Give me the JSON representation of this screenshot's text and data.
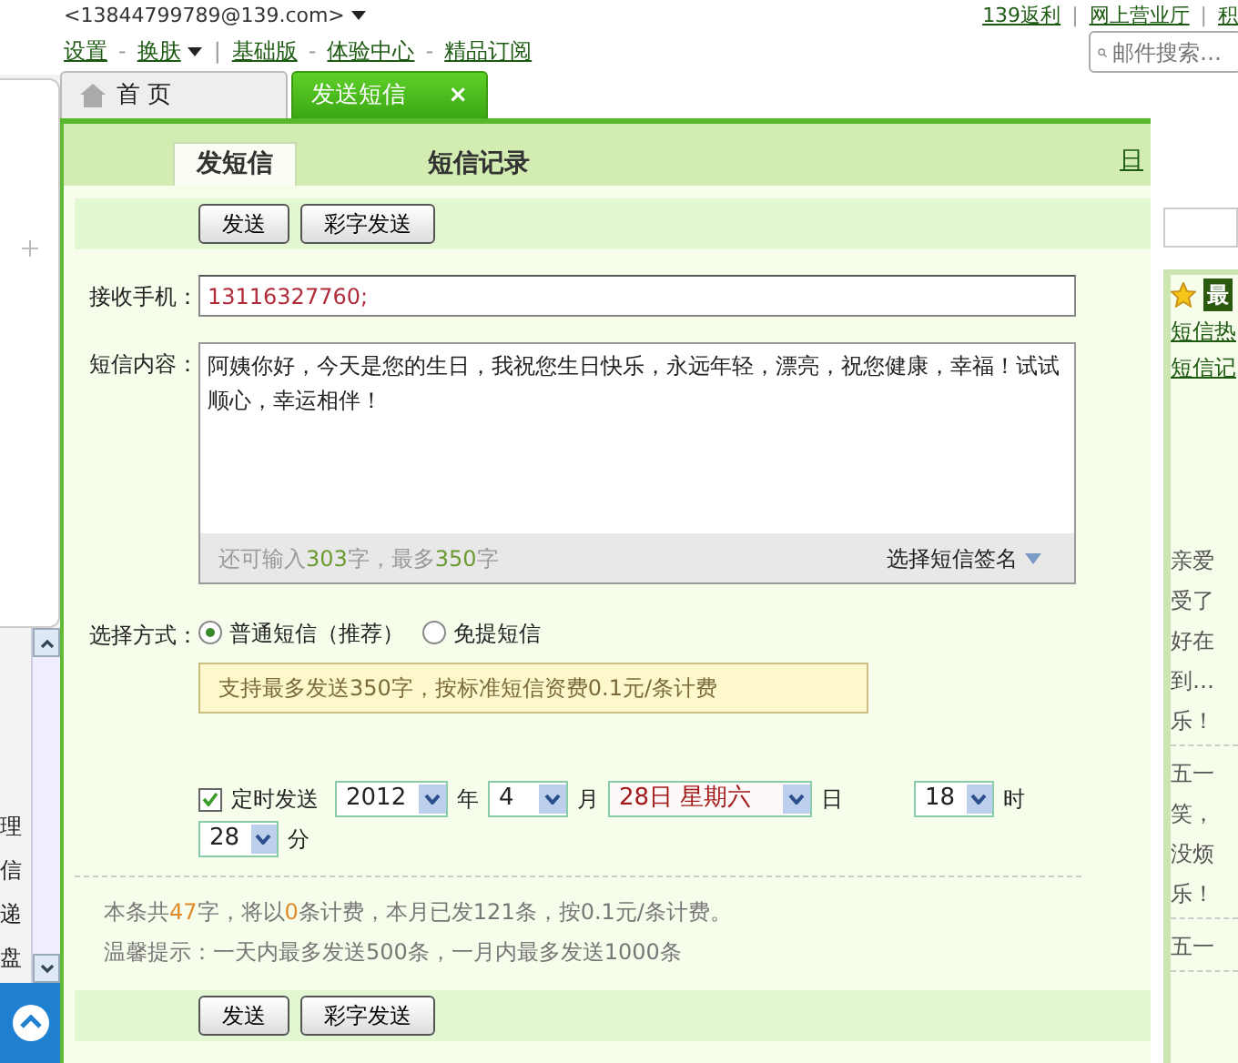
{
  "account": {
    "email": "<13844799789@139.com>"
  },
  "top_links": [
    {
      "label": "139返利"
    },
    {
      "label": "网上营业厅",
      "separator_before": "|"
    },
    {
      "label": "积",
      "separator_before": "|"
    }
  ],
  "menu": [
    {
      "label": "设置",
      "dropdown": false
    },
    {
      "label": "换肤",
      "separator_before": "-",
      "dropdown": true
    },
    {
      "label": "基础版",
      "separator_before": "|",
      "dropdown": false
    },
    {
      "label": "体验中心",
      "separator_before": "-",
      "dropdown": false
    },
    {
      "label": "精品订阅",
      "separator_before": "-",
      "dropdown": false
    }
  ],
  "search": {
    "placeholder": "邮件搜索…"
  },
  "tabs": [
    {
      "label": "首 页",
      "selected": false
    },
    {
      "label": "发送短信",
      "selected": true,
      "close": "×"
    }
  ],
  "subtabs": [
    {
      "label": "发短信",
      "selected": true
    },
    {
      "label": "短信记录",
      "selected": false
    }
  ],
  "subnav_right": "日",
  "toolbar_top": {
    "buttons": [
      "发送",
      "彩字发送"
    ]
  },
  "recipient": {
    "label": "接收手机：",
    "value": "13116327760;"
  },
  "content": {
    "label": "短信内容：",
    "value": "阿姨你好，今天是您的生日，我祝您生日快乐，永远年轻，漂亮，祝您健康，幸福！试试顺心，幸运相伴！",
    "counter": [
      {
        "text": "还可输入",
        "highlight": false
      },
      {
        "text": "303",
        "highlight": true
      },
      {
        "text": "字，最多",
        "highlight": false
      },
      {
        "text": "350",
        "highlight": true
      },
      {
        "text": "字",
        "highlight": false
      }
    ],
    "signature": "选择短信签名"
  },
  "send_mode": {
    "label": "选择方式：",
    "options": [
      {
        "label": "普通短信（推荐）",
        "selected": true
      },
      {
        "label": "免提短信",
        "selected": false
      }
    ],
    "tip": "支持最多发送350字，按标准短信资费0.1元/条计费"
  },
  "schedule": {
    "label": "定时发送",
    "checked": true,
    "fields": [
      {
        "value": "2012",
        "unit": "年",
        "highlight": false
      },
      {
        "value": "4",
        "unit": "月",
        "highlight": false
      },
      {
        "value": "28日 星期六",
        "unit": "日",
        "highlight": true
      },
      {
        "value": "18",
        "unit": "时",
        "highlight": false
      },
      {
        "value": "28",
        "unit": "分",
        "highlight": false
      }
    ]
  },
  "summary": [
    {
      "text": "本条共",
      "highlight": false
    },
    {
      "text": "47",
      "highlight": true
    },
    {
      "text": "字，将以",
      "highlight": false
    },
    {
      "text": "0",
      "highlight": true
    },
    {
      "text": "条计费，本月已发121条，按0.1元/条计费。",
      "highlight": false
    }
  ],
  "hint": "温馨提示：一天内最多发送500条，一月内最多发送1000条",
  "toolbar_bottom": {
    "buttons": [
      "发送",
      "彩字发送"
    ]
  },
  "side_panel": {
    "badge": "最",
    "links": [
      "短信热",
      "短信记"
    ],
    "snippets": [
      [
        "亲爱",
        "受了",
        "好在",
        "到…",
        "乐！"
      ],
      [
        "五一",
        "笑，",
        "没烦",
        "乐！"
      ],
      [
        "五一"
      ]
    ]
  },
  "sidebar": {
    "items": [
      "理",
      "信",
      "递",
      "盘"
    ]
  }
}
